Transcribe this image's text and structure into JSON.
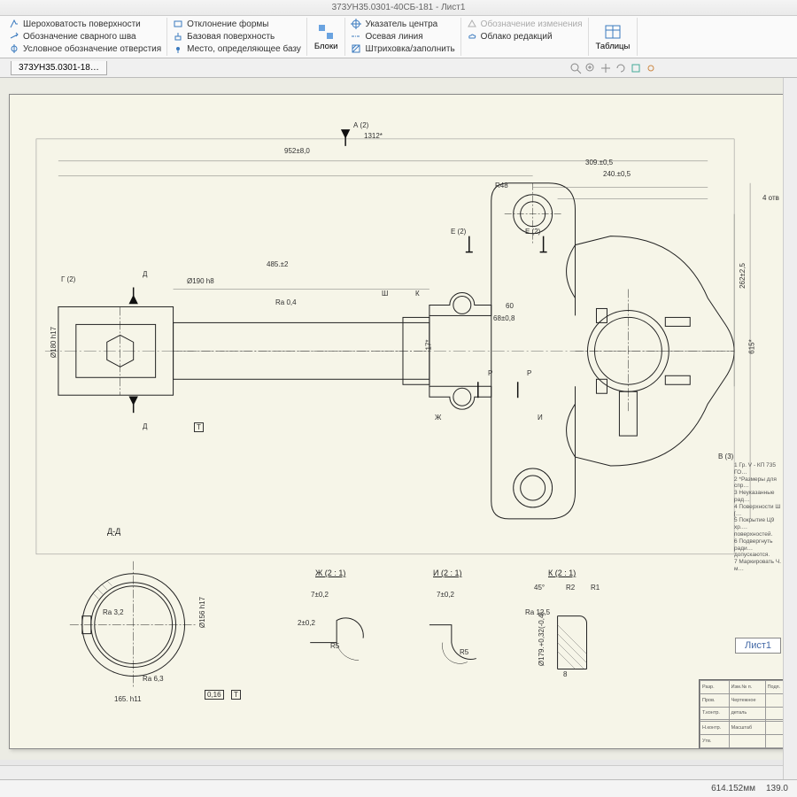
{
  "title": "373УН35.0301-40СБ-181 - Лист1",
  "ribbon": {
    "col1": [
      {
        "icon": "roughness",
        "label": "Шероховатость поверхности"
      },
      {
        "icon": "weld",
        "label": "Обозначение сварного шва"
      },
      {
        "icon": "hole",
        "label": "Условное обозначение отверстия"
      }
    ],
    "col2": [
      {
        "icon": "form",
        "label": "Отклонение формы"
      },
      {
        "icon": "surface",
        "label": "Базовая поверхность"
      },
      {
        "icon": "datum",
        "label": "Место, определяющее базу"
      }
    ],
    "blocks_label": "Блоки",
    "col3": [
      {
        "icon": "center",
        "label": "Указатель центра"
      },
      {
        "icon": "axis",
        "label": "Осевая линия"
      },
      {
        "icon": "hatch",
        "label": "Штриховка/заполнить"
      }
    ],
    "col4": [
      {
        "icon": "change",
        "label": "Обозначение изменения"
      },
      {
        "icon": "cloud",
        "label": "Облако редакций"
      }
    ],
    "tables_label": "Таблицы"
  },
  "page_tab": "373УН35.0301-18…",
  "main_view": {
    "dims": {
      "overall": "1312*",
      "length": "952±8,0",
      "right1": "309.±0,5",
      "right2": "240.±0,5",
      "radius_top": "R48",
      "radius_right": "4 отв",
      "mid": "485.±2",
      "dia_left": "Ø190 h8",
      "ra": "Ra 0,4",
      "small1": "60",
      "small2": "68±0,8",
      "tol": "17*",
      "height_r": "615*",
      "height_r2": "262±2,5",
      "left_dia": "Ø180 h17"
    },
    "refs": {
      "A": "А (2)",
      "E1": "Е (2)",
      "E2": "Е (2)",
      "G": "Г (2)",
      "D": "Д",
      "Sh": "Ш",
      "K": "К",
      "Zh": "Ж",
      "I": "И",
      "P": "Р",
      "T": "Т",
      "B": "В (3)"
    }
  },
  "detail_views": {
    "DD": {
      "label": "Д-Д",
      "dims": {
        "ra1": "Ra 3,2",
        "ra2": "Ra 6,3",
        "d1": "Ø156 h17",
        "len": "165. h11",
        "gd": "0,16",
        "datum": "Т"
      }
    },
    "Zh": {
      "label": "Ж (2 : 1)",
      "dims": {
        "a": "7±0,2",
        "b": "2±0,2",
        "r": "R5"
      }
    },
    "I": {
      "label": "И (2 : 1)",
      "dims": {
        "a": "7±0,2",
        "r": "R5"
      }
    },
    "K": {
      "label": "К (2 : 1)",
      "dims": {
        "ang": "45°",
        "r1": "R2",
        "r2": "R1",
        "ra": "Ra 12,5",
        "d": "Ø179.+0,32(-0,4)",
        "w": "8"
      }
    }
  },
  "notes": [
    "1 Гр. V - КП 735 ГО…",
    "2 *Размеры для спр…",
    "3 Неуказанные рад…",
    "4 Поверхности Ш […",
    "5 Покрытие Ц9 хр.…",
    "поверхностей.",
    "6 Подвергнуть ради…",
    "допускаются.",
    "7 Маркировать Ч. м…"
  ],
  "sheet_tag": "Лист1",
  "title_block": {
    "rows": [
      [
        "Разр.",
        "Изм.№ п.",
        "Подп."
      ],
      [
        "Пров.",
        "Чертежное",
        ""
      ],
      [
        "Т.контр.",
        "деталь",
        ""
      ],
      [
        "",
        "",
        ""
      ],
      [
        "Н.контр.",
        "Масштаб",
        ""
      ],
      [
        "Утв.",
        "",
        ""
      ]
    ]
  },
  "status": {
    "coord": "614.152мм",
    "coord2": "139.0"
  }
}
